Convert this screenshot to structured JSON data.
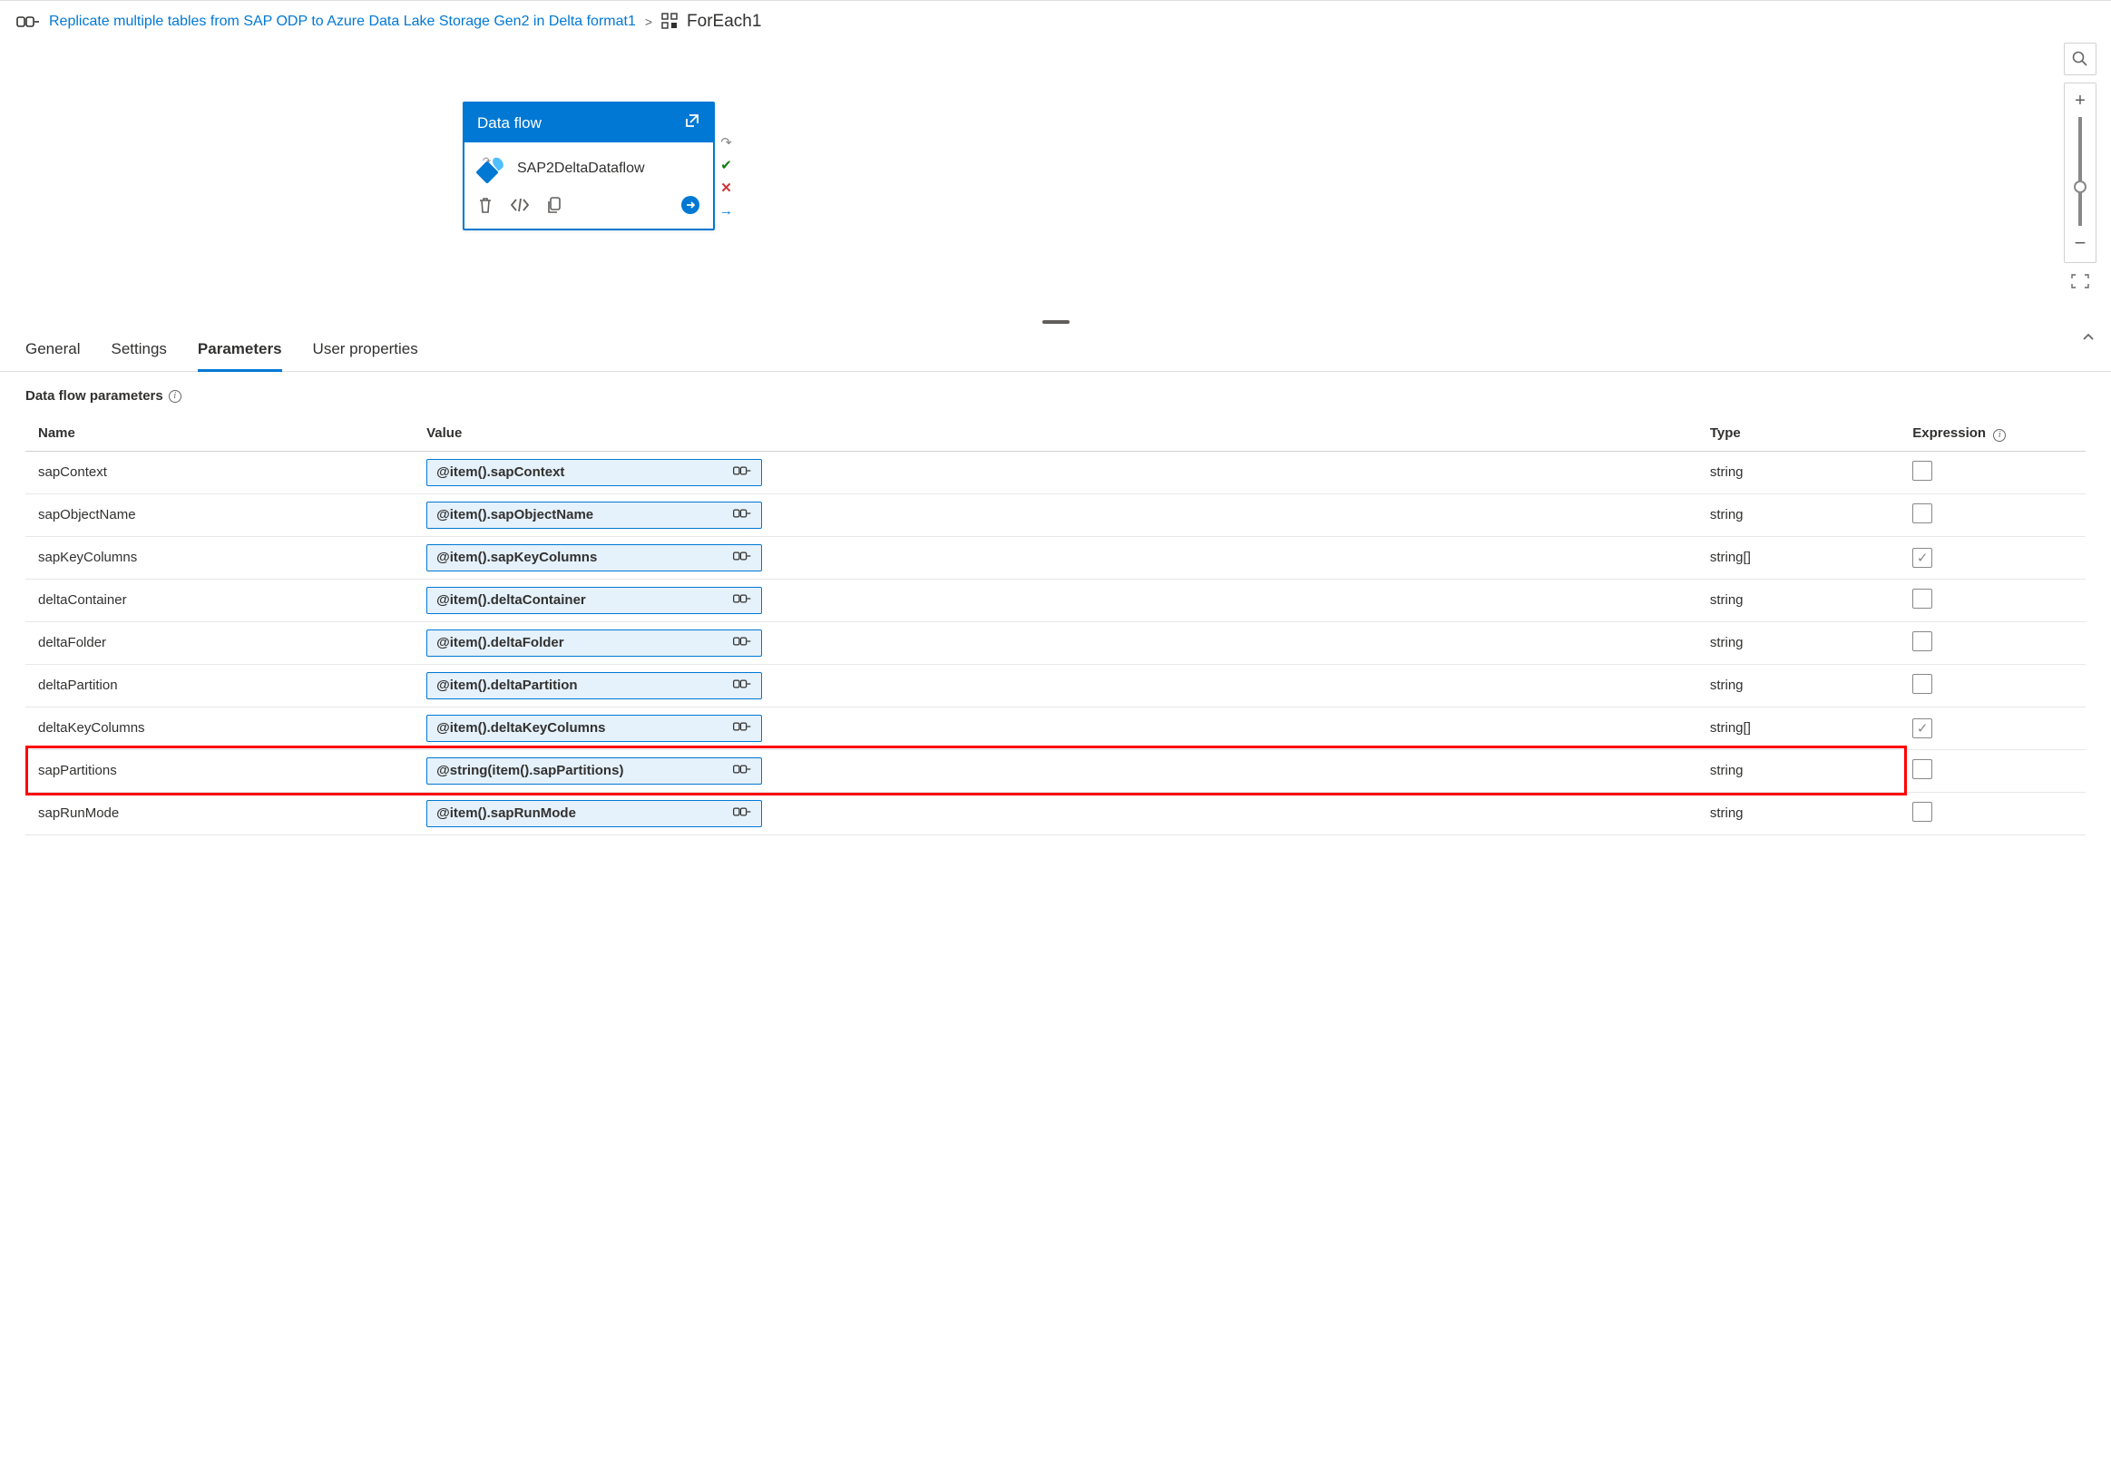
{
  "breadcrumb": {
    "parent": "Replicate multiple tables from SAP ODP to Azure Data Lake Storage Gen2 in Delta format1",
    "current": "ForEach1"
  },
  "activity": {
    "type_label": "Data flow",
    "name": "SAP2DeltaDataflow"
  },
  "tabs": [
    {
      "label": "General"
    },
    {
      "label": "Settings"
    },
    {
      "label": "Parameters"
    },
    {
      "label": "User properties"
    }
  ],
  "active_tab_index": 2,
  "section_title": "Data flow parameters",
  "table": {
    "headers": {
      "name": "Name",
      "value": "Value",
      "type": "Type",
      "expression": "Expression"
    },
    "rows": [
      {
        "name": "sapContext",
        "value": "@item().sapContext",
        "type": "string",
        "expression_checked": false,
        "highlight": false
      },
      {
        "name": "sapObjectName",
        "value": "@item().sapObjectName",
        "type": "string",
        "expression_checked": false,
        "highlight": false
      },
      {
        "name": "sapKeyColumns",
        "value": "@item().sapKeyColumns",
        "type": "string[]",
        "expression_checked": true,
        "highlight": false
      },
      {
        "name": "deltaContainer",
        "value": "@item().deltaContainer",
        "type": "string",
        "expression_checked": false,
        "highlight": false
      },
      {
        "name": "deltaFolder",
        "value": "@item().deltaFolder",
        "type": "string",
        "expression_checked": false,
        "highlight": false
      },
      {
        "name": "deltaPartition",
        "value": "@item().deltaPartition",
        "type": "string",
        "expression_checked": false,
        "highlight": false
      },
      {
        "name": "deltaKeyColumns",
        "value": "@item().deltaKeyColumns",
        "type": "string[]",
        "expression_checked": true,
        "highlight": false
      },
      {
        "name": "sapPartitions",
        "value": "@string(item().sapPartitions)",
        "type": "string",
        "expression_checked": false,
        "highlight": true
      },
      {
        "name": "sapRunMode",
        "value": "@item().sapRunMode",
        "type": "string",
        "expression_checked": false,
        "highlight": false
      }
    ]
  }
}
